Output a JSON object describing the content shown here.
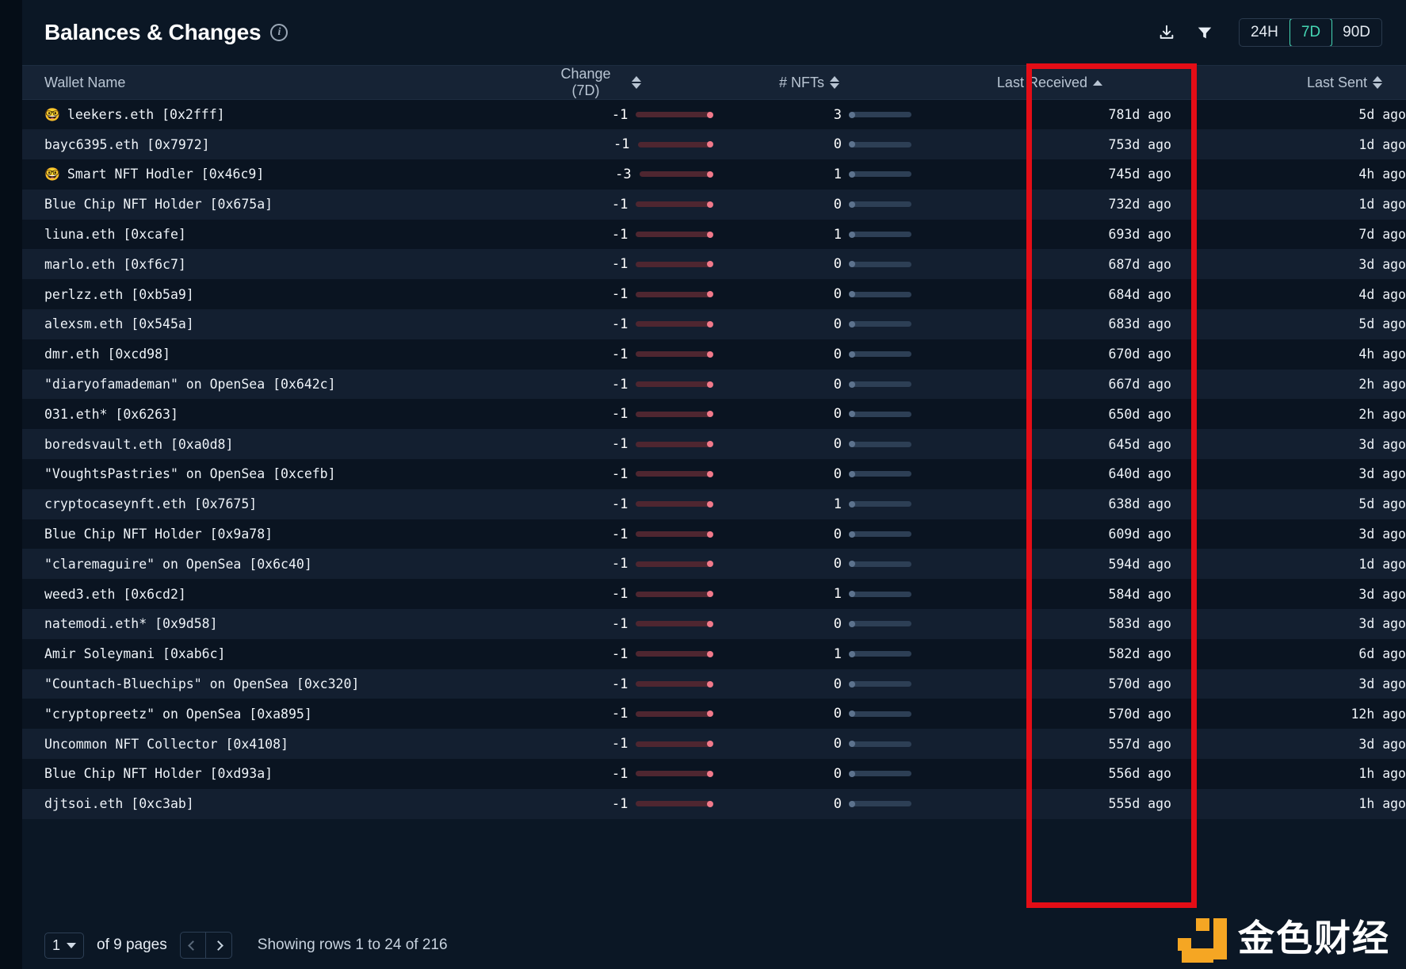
{
  "header": {
    "title": "Balances & Changes",
    "info_icon": "info-icon",
    "download_icon": "download-icon",
    "filter_icon": "filter-icon",
    "ranges": [
      {
        "label": "24H",
        "active": false
      },
      {
        "label": "7D",
        "active": true
      },
      {
        "label": "90D",
        "active": false
      }
    ],
    "accent_color": "#45d7b4"
  },
  "table": {
    "columns": [
      {
        "key": "wallet",
        "label": "Wallet Name",
        "align": "left",
        "sort": "none"
      },
      {
        "key": "change",
        "label": "Change (7D)",
        "align": "left",
        "sort": "both"
      },
      {
        "key": "nfts",
        "label": "# NFTs",
        "align": "left",
        "sort": "both"
      },
      {
        "key": "last_received",
        "label": "Last Received",
        "align": "right",
        "sort": "asc"
      },
      {
        "key": "last_sent",
        "label": "Last Sent",
        "align": "right",
        "sort": "both"
      }
    ],
    "rows": [
      {
        "wallet": "leekers.eth [0x2fff]",
        "nerd": true,
        "change": "-1",
        "change_bar": 92,
        "nfts": "3",
        "nft_bar": 100,
        "last_received": "781d ago",
        "last_sent": "5d ago"
      },
      {
        "wallet": "bayc6395.eth [0x7972]",
        "nerd": false,
        "change": "-1",
        "change_bar": 90,
        "nfts": "0",
        "nft_bar": 100,
        "last_received": "753d ago",
        "last_sent": "1d ago"
      },
      {
        "wallet": "Smart NFT Hodler [0x46c9]",
        "nerd": true,
        "change": "-3",
        "change_bar": 88,
        "nfts": "1",
        "nft_bar": 100,
        "last_received": "745d ago",
        "last_sent": "4h ago"
      },
      {
        "wallet": "Blue Chip NFT Holder [0x675a]",
        "nerd": false,
        "change": "-1",
        "change_bar": 92,
        "nfts": "0",
        "nft_bar": 100,
        "last_received": "732d ago",
        "last_sent": "1d ago"
      },
      {
        "wallet": "liuna.eth [0xcafe]",
        "nerd": false,
        "change": "-1",
        "change_bar": 92,
        "nfts": "1",
        "nft_bar": 100,
        "last_received": "693d ago",
        "last_sent": "7d ago"
      },
      {
        "wallet": "marlo.eth [0xf6c7]",
        "nerd": false,
        "change": "-1",
        "change_bar": 92,
        "nfts": "0",
        "nft_bar": 100,
        "last_received": "687d ago",
        "last_sent": "3d ago"
      },
      {
        "wallet": "perlzz.eth [0xb5a9]",
        "nerd": false,
        "change": "-1",
        "change_bar": 92,
        "nfts": "0",
        "nft_bar": 100,
        "last_received": "684d ago",
        "last_sent": "4d ago"
      },
      {
        "wallet": "alexsm.eth [0x545a]",
        "nerd": false,
        "change": "-1",
        "change_bar": 92,
        "nfts": "0",
        "nft_bar": 100,
        "last_received": "683d ago",
        "last_sent": "5d ago"
      },
      {
        "wallet": "dmr.eth [0xcd98]",
        "nerd": false,
        "change": "-1",
        "change_bar": 92,
        "nfts": "0",
        "nft_bar": 100,
        "last_received": "670d ago",
        "last_sent": "4h ago"
      },
      {
        "wallet": "\"diaryofamademan\" on OpenSea [0x642c]",
        "nerd": false,
        "change": "-1",
        "change_bar": 92,
        "nfts": "0",
        "nft_bar": 100,
        "last_received": "667d ago",
        "last_sent": "2h ago"
      },
      {
        "wallet": "031.eth* [0x6263]",
        "nerd": false,
        "change": "-1",
        "change_bar": 92,
        "nfts": "0",
        "nft_bar": 100,
        "last_received": "650d ago",
        "last_sent": "2h ago"
      },
      {
        "wallet": "boredsvault.eth [0xa0d8]",
        "nerd": false,
        "change": "-1",
        "change_bar": 92,
        "nfts": "0",
        "nft_bar": 100,
        "last_received": "645d ago",
        "last_sent": "3d ago"
      },
      {
        "wallet": "\"VoughtsPastries\" on OpenSea [0xcefb]",
        "nerd": false,
        "change": "-1",
        "change_bar": 92,
        "nfts": "0",
        "nft_bar": 100,
        "last_received": "640d ago",
        "last_sent": "3d ago"
      },
      {
        "wallet": "cryptocaseynft.eth [0x7675]",
        "nerd": false,
        "change": "-1",
        "change_bar": 92,
        "nfts": "1",
        "nft_bar": 100,
        "last_received": "638d ago",
        "last_sent": "5d ago"
      },
      {
        "wallet": "Blue Chip NFT Holder [0x9a78]",
        "nerd": false,
        "change": "-1",
        "change_bar": 92,
        "nfts": "0",
        "nft_bar": 100,
        "last_received": "609d ago",
        "last_sent": "3d ago"
      },
      {
        "wallet": "\"claremaguire\" on OpenSea [0x6c40]",
        "nerd": false,
        "change": "-1",
        "change_bar": 92,
        "nfts": "0",
        "nft_bar": 100,
        "last_received": "594d ago",
        "last_sent": "1d ago"
      },
      {
        "wallet": "weed3.eth [0x6cd2]",
        "nerd": false,
        "change": "-1",
        "change_bar": 92,
        "nfts": "1",
        "nft_bar": 100,
        "last_received": "584d ago",
        "last_sent": "3d ago"
      },
      {
        "wallet": "natemodi.eth* [0x9d58]",
        "nerd": false,
        "change": "-1",
        "change_bar": 92,
        "nfts": "0",
        "nft_bar": 100,
        "last_received": "583d ago",
        "last_sent": "3d ago"
      },
      {
        "wallet": "Amir Soleymani [0xab6c]",
        "nerd": false,
        "change": "-1",
        "change_bar": 92,
        "nfts": "1",
        "nft_bar": 100,
        "last_received": "582d ago",
        "last_sent": "6d ago"
      },
      {
        "wallet": "\"Countach-Bluechips\" on OpenSea [0xc320]",
        "nerd": false,
        "change": "-1",
        "change_bar": 92,
        "nfts": "0",
        "nft_bar": 100,
        "last_received": "570d ago",
        "last_sent": "3d ago"
      },
      {
        "wallet": "\"cryptopreetz\" on OpenSea [0xa895]",
        "nerd": false,
        "change": "-1",
        "change_bar": 92,
        "nfts": "0",
        "nft_bar": 100,
        "last_received": "570d ago",
        "last_sent": "12h ago"
      },
      {
        "wallet": "Uncommon NFT Collector [0x4108]",
        "nerd": false,
        "change": "-1",
        "change_bar": 92,
        "nfts": "0",
        "nft_bar": 100,
        "last_received": "557d ago",
        "last_sent": "3d ago"
      },
      {
        "wallet": "Blue Chip NFT Holder [0xd93a]",
        "nerd": false,
        "change": "-1",
        "change_bar": 92,
        "nfts": "0",
        "nft_bar": 100,
        "last_received": "556d ago",
        "last_sent": "1h ago"
      },
      {
        "wallet": "djtsoi.eth [0xc3ab]",
        "nerd": false,
        "change": "-1",
        "change_bar": 92,
        "nfts": "0",
        "nft_bar": 100,
        "last_received": "555d ago",
        "last_sent": "1h ago"
      }
    ]
  },
  "footer": {
    "current_page": "1",
    "of_pages": "of 9 pages",
    "prev_label": "previous-page",
    "next_label": "next-page",
    "showing": "Showing rows 1 to 24 of 216"
  },
  "watermark": {
    "text": "金色财经",
    "logo_color": "#f5a623"
  },
  "annotation": {
    "color": "#e40d16",
    "target_column": "Last Received"
  }
}
